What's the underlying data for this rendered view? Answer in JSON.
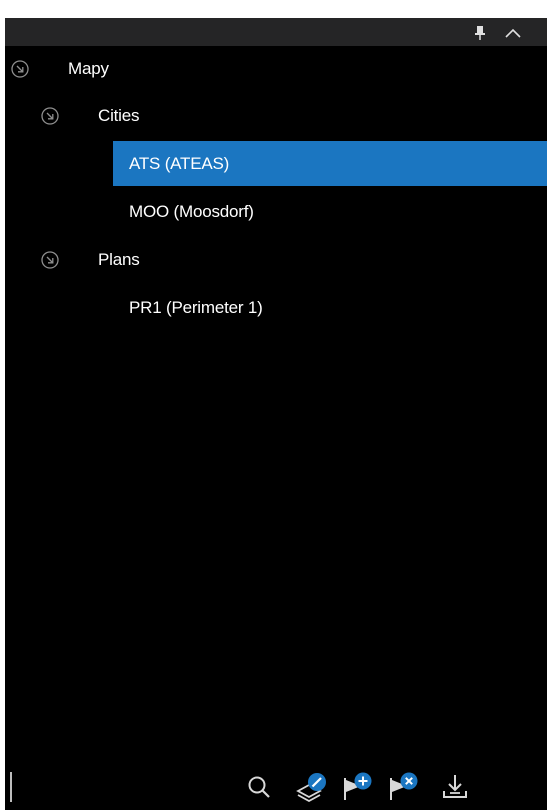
{
  "panel": {
    "header_icons": [
      "pin-icon",
      "collapse-chevron-up-icon"
    ]
  },
  "tree": {
    "root": {
      "label": "Mapy",
      "icon": "expand-collapse-circle-icon",
      "children": [
        {
          "label": "Cities",
          "icon": "expand-collapse-circle-icon",
          "children": [
            {
              "label": "ATS (ATEAS)",
              "selected": true
            },
            {
              "label": "MOO (Moosdorf)",
              "selected": false
            }
          ]
        },
        {
          "label": "Plans",
          "icon": "expand-collapse-circle-icon",
          "children": [
            {
              "label": "PR1 (Perimeter 1)",
              "selected": false
            }
          ]
        }
      ]
    }
  },
  "toolbar": {
    "icons": [
      "search-icon",
      "edit-layer-icon",
      "add-flag-icon",
      "remove-flag-icon",
      "download-icon"
    ]
  },
  "colors": {
    "panel_bg": "#000000",
    "header_bg": "#252526",
    "selection": "#1b76c1",
    "text": "#ffffff",
    "icon_gray": "#8f8f8f",
    "badge_blue": "#1b76c1"
  }
}
